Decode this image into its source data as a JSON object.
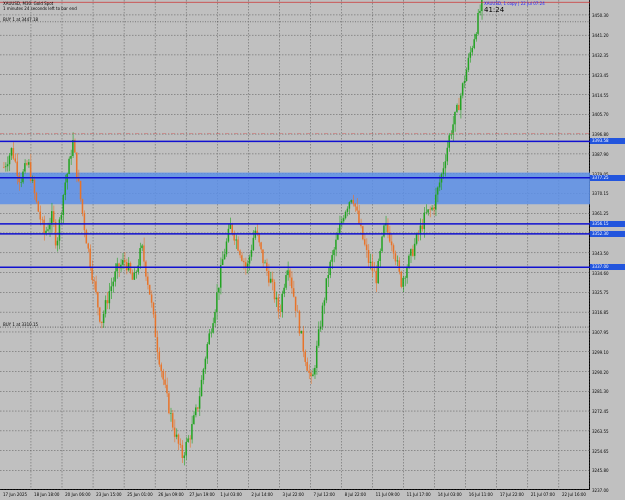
{
  "header": {
    "symbol_line": "XAUUSD, M30: Gold Spot",
    "info_line": "1 minutes 24 seconds left to bar end"
  },
  "orders": [
    {
      "label": "BUY 1 at 3447.18",
      "price": 3447.18
    },
    {
      "label": "BUY 1 at 3310.15",
      "price": 3310.15
    }
  ],
  "timer": "41:24",
  "time_tag": "XAUUSD, 1 copy | 22 Jul 07:24",
  "price_axis": {
    "min": 3237.0,
    "max": 3457.0,
    "ticks": [
      "3450.30",
      "3441.20",
      "3432.35",
      "3423.45",
      "3414.55",
      "3405.70",
      "3396.80",
      "3387.90",
      "3379.05",
      "3370.15",
      "3361.25",
      "3352.40",
      "3343.50",
      "3334.60",
      "3325.75",
      "3316.85",
      "3307.95",
      "3299.10",
      "3290.20",
      "3281.30",
      "3272.45",
      "3263.55",
      "3254.65",
      "3245.80",
      "3237.00"
    ]
  },
  "time_axis": {
    "labels": [
      "17 Jun 2025",
      "18 Jun 18:00",
      "20 Jun 06:00",
      "23 Jun 15:00",
      "25 Jun 01:00",
      "26 Jun 09:00",
      "27 Jun 19:00",
      "1 Jul 03:00",
      "2 Jul 14:00",
      "3 Jul 22:00",
      "7 Jul 12:00",
      "8 Jul 22:00",
      "11 Jul 09:00",
      "11 Jul 17:00",
      "14 Jul 03:00",
      "16 Jul 11:00",
      "17 Jul 22:00",
      "21 Jul 07:00",
      "22 Jul 16:00"
    ]
  },
  "levels": {
    "zone": {
      "top": 3379.5,
      "bottom": 3365.3,
      "color": "#5c8fe8"
    },
    "h_lines": [
      {
        "price": 3393.5,
        "tag": "3393.58"
      },
      {
        "price": 3377.2,
        "tag": "3377.25"
      },
      {
        "price": 3356.5,
        "tag": "3356.15"
      },
      {
        "price": 3352.0,
        "tag": "3352.30"
      },
      {
        "price": 3337.0,
        "tag": "3337.00"
      }
    ],
    "bid_line": {
      "price": 3456.0
    },
    "dashdot_line": {
      "price": 3397.0
    }
  },
  "colors": {
    "background": "#c0c0c0",
    "bull": "#22a322",
    "bear": "#e8742a",
    "line_blue": "#1010d0",
    "bid": "#cc3333",
    "grid": "#555555",
    "tag_bg": "#2255dd"
  },
  "chart_data": {
    "type": "candlestick",
    "symbol": "XAUUSD",
    "timeframe": "M30",
    "close_path": [
      [
        0,
        3382
      ],
      [
        2,
        3390
      ],
      [
        4,
        3376
      ],
      [
        6,
        3384
      ],
      [
        8,
        3366
      ],
      [
        10,
        3352
      ],
      [
        12,
        3360
      ],
      [
        13,
        3347
      ],
      [
        15,
        3374
      ],
      [
        16,
        3382
      ],
      [
        17,
        3394
      ],
      [
        18,
        3380
      ],
      [
        20,
        3354
      ],
      [
        22,
        3332
      ],
      [
        24,
        3312
      ],
      [
        26,
        3326
      ],
      [
        28,
        3336
      ],
      [
        30,
        3340
      ],
      [
        32,
        3330
      ],
      [
        34,
        3346
      ],
      [
        36,
        3326
      ],
      [
        38,
        3300
      ],
      [
        40,
        3280
      ],
      [
        42,
        3264
      ],
      [
        44,
        3252
      ],
      [
        46,
        3262
      ],
      [
        48,
        3276
      ],
      [
        50,
        3300
      ],
      [
        52,
        3318
      ],
      [
        54,
        3340
      ],
      [
        56,
        3356
      ],
      [
        58,
        3346
      ],
      [
        60,
        3336
      ],
      [
        62,
        3354
      ],
      [
        64,
        3340
      ],
      [
        66,
        3330
      ],
      [
        68,
        3316
      ],
      [
        70,
        3340
      ],
      [
        72,
        3320
      ],
      [
        74,
        3300
      ],
      [
        76,
        3284
      ],
      [
        78,
        3310
      ],
      [
        80,
        3334
      ],
      [
        82,
        3348
      ],
      [
        84,
        3362
      ],
      [
        86,
        3370
      ],
      [
        88,
        3354
      ],
      [
        90,
        3340
      ],
      [
        92,
        3332
      ],
      [
        94,
        3356
      ],
      [
        96,
        3348
      ],
      [
        98,
        3330
      ],
      [
        100,
        3340
      ],
      [
        102,
        3350
      ],
      [
        104,
        3360
      ],
      [
        106,
        3364
      ],
      [
        108,
        3378
      ],
      [
        110,
        3396
      ],
      [
        112,
        3408
      ],
      [
        114,
        3424
      ],
      [
        116,
        3440
      ],
      [
        118,
        3456
      ]
    ]
  }
}
